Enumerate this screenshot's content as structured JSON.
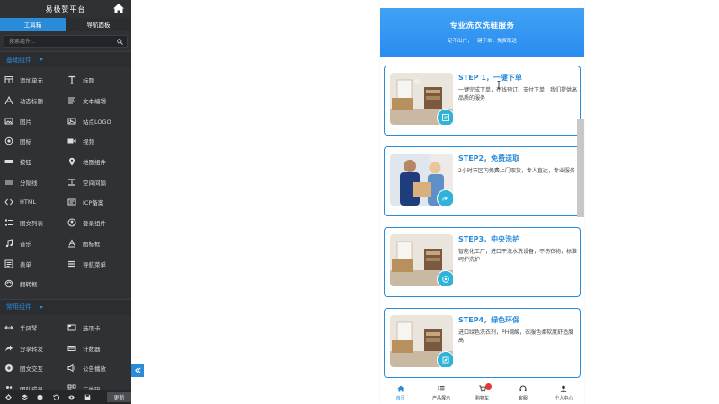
{
  "sidebar": {
    "title": "易极赞平台",
    "tabs": [
      {
        "label": "工具箱"
      },
      {
        "label": "导航面板"
      }
    ],
    "search_placeholder": "搜索组件...",
    "basic_section": "基础组件",
    "basic_items": [
      {
        "label": "添加单元",
        "icon": "layout-icon"
      },
      {
        "label": "标题",
        "icon": "title-icon"
      },
      {
        "label": "动态标题",
        "icon": "dynamic-title-icon"
      },
      {
        "label": "文本编辑",
        "icon": "text-edit-icon"
      },
      {
        "label": "图片",
        "icon": "image-icon"
      },
      {
        "label": "站点LOGO",
        "icon": "logo-icon"
      },
      {
        "label": "图标",
        "icon": "icon-icon"
      },
      {
        "label": "视频",
        "icon": "video-icon"
      },
      {
        "label": "按钮",
        "icon": "button-icon"
      },
      {
        "label": "地图组件",
        "icon": "map-pin-icon"
      },
      {
        "label": "分隔线",
        "icon": "divider-icon"
      },
      {
        "label": "空间间隔",
        "icon": "spacer-icon"
      },
      {
        "label": "HTML",
        "icon": "code-icon"
      },
      {
        "label": "ICP备案",
        "icon": "icp-icon"
      },
      {
        "label": "图文列表",
        "icon": "list-icon"
      },
      {
        "label": "登录组件",
        "icon": "login-icon"
      },
      {
        "label": "音乐",
        "icon": "music-icon"
      },
      {
        "label": "图标框",
        "icon": "icon-box-icon"
      },
      {
        "label": "表单",
        "icon": "form-icon"
      },
      {
        "label": "导航菜单",
        "icon": "nav-menu-icon"
      },
      {
        "label": "翻转框",
        "icon": "flip-icon"
      }
    ],
    "common_section": "常用组件",
    "common_items": [
      {
        "label": "手风琴",
        "icon": "accordion-icon"
      },
      {
        "label": "选项卡",
        "icon": "tabs-icon"
      },
      {
        "label": "分享转发",
        "icon": "share-icon"
      },
      {
        "label": "计数器",
        "icon": "counter-icon"
      },
      {
        "label": "图文交互",
        "icon": "interact-icon"
      },
      {
        "label": "公告播放",
        "icon": "announcement-icon"
      },
      {
        "label": "团队成员",
        "icon": "team-icon"
      },
      {
        "label": "二维码",
        "icon": "qrcode-icon"
      }
    ],
    "update_label": "更新",
    "accent": "#2a8bd8"
  },
  "phone": {
    "banner_title": "专业洗衣洗鞋服务",
    "banner_subtitle": "足不出户，一键下单，免费取送",
    "steps": [
      {
        "title": "STEP 1，一键下单",
        "desc": "一键完成下单，在线预订、支付下单，我们提供高品质的服务"
      },
      {
        "title": "STEP2，免费送取",
        "desc": "2小时市区内免费上门取货，专人直达，专业服务"
      },
      {
        "title": "STEP3，中央洗护",
        "desc": "智能化工厂，进口干洗水洗设备，不伤衣物，标准呵护洗护"
      },
      {
        "title": "STEP4，绿色环保",
        "desc": "进口绿色洗衣剂，PH调酸，衣服色柔软度舒适度高"
      }
    ],
    "tabbar": [
      {
        "label": "首页",
        "icon": "home-icon"
      },
      {
        "label": "产品展示",
        "icon": "list-icon"
      },
      {
        "label": "购物车",
        "icon": "cart-icon"
      },
      {
        "label": "客服",
        "icon": "headset-icon"
      },
      {
        "label": "个人中心",
        "icon": "user-icon"
      }
    ]
  }
}
